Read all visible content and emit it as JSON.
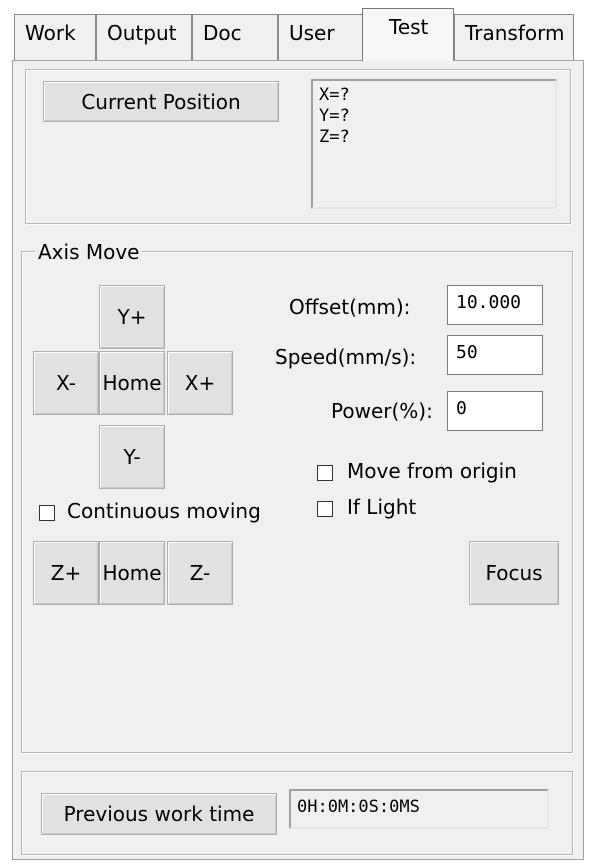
{
  "tabs": [
    "Work",
    "Output",
    "Doc",
    "User",
    "Test",
    "Transform"
  ],
  "active_tab": "Test",
  "position": {
    "button_label": "Current Position",
    "lines": [
      "X=?",
      "Y=?",
      "Z=?"
    ]
  },
  "axis_move": {
    "legend": "Axis Move",
    "y_plus": "Y+",
    "y_minus": "Y-",
    "x_minus": "X-",
    "x_plus": "X+",
    "home_xy": "Home",
    "continuous_label": "Continuous moving",
    "continuous_checked": false,
    "z_plus": "Z+",
    "home_z": "Home",
    "z_minus": "Z-",
    "offset_label": "Offset(mm):",
    "offset_value": "10.000",
    "speed_label": "Speed(mm/s):",
    "speed_value": "50",
    "power_label": "Power(%):",
    "power_value": "0",
    "move_origin_label": "Move from origin",
    "move_origin_checked": false,
    "if_light_label": "If Light",
    "if_light_checked": false,
    "focus_label": "Focus"
  },
  "work_time": {
    "button_label": "Previous work time",
    "value": "0H:0M:0S:0MS"
  }
}
